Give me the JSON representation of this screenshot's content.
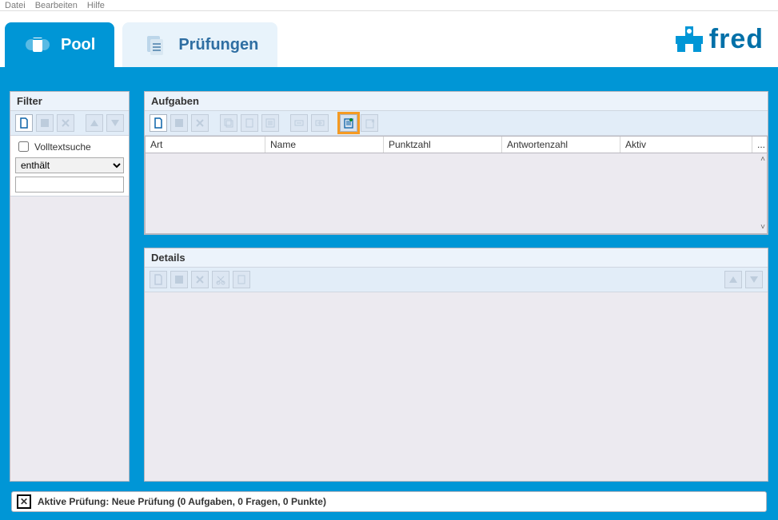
{
  "menu": {
    "datei": "Datei",
    "bearbeiten": "Bearbeiten",
    "hilfe": "Hilfe"
  },
  "tabs": {
    "pool": "Pool",
    "pruefungen": "Prüfungen"
  },
  "brand": {
    "text": "fred"
  },
  "filter": {
    "title": "Filter",
    "volltext_label": "Volltextsuche",
    "mode_selected": "enthält",
    "search_value": ""
  },
  "aufgaben": {
    "title": "Aufgaben",
    "columns": {
      "art": "Art",
      "name": "Name",
      "punktzahl": "Punktzahl",
      "antwortenzahl": "Antwortenzahl",
      "aktiv": "Aktiv"
    },
    "more": "..."
  },
  "details": {
    "title": "Details"
  },
  "status": {
    "label": "Aktive Prüfung:",
    "value": "Neue Prüfung (0 Aufgaben, 0 Fragen, 0 Punkte)"
  },
  "colors": {
    "primary": "#0096d6",
    "accent": "#f59a22"
  }
}
